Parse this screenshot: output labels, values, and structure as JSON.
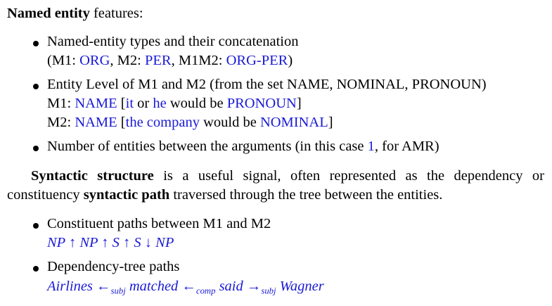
{
  "heading": {
    "bold": "Named entity",
    "rest": " features:"
  },
  "ne_items": [
    {
      "line1": "Named-entity types and their concatenation",
      "line2": {
        "p1": "(M1: ",
        "v1": "ORG",
        "p2": ", M2: ",
        "v2": "PER",
        "p3": ", M1M2: ",
        "v3": "ORG-PER",
        "p4": ")"
      }
    },
    {
      "line1": "Entity Level of M1 and M2 (from the set NAME, NOMINAL, PRONOUN)",
      "line2": {
        "p1": "M1: ",
        "v1": "NAME",
        "p2": " [",
        "v2": "it",
        "p3": " or ",
        "v3": "he",
        "p4": " would be ",
        "v4": "PRONOUN",
        "p5": "]"
      },
      "line3": {
        "p1": "M2: ",
        "v1": "NAME",
        "p2": " [",
        "v2": "the company",
        "p3": " would be ",
        "v3": "NOMINAL",
        "p4": "]"
      }
    },
    {
      "line1": {
        "p1": "Number of entities between the arguments (in this case ",
        "v1": "1",
        "p2": ", for AMR)"
      }
    }
  ],
  "paragraph": {
    "line1": {
      "bold1": "Syntactic structure",
      "rest1": " is a useful signal, often represented as the dependency or"
    },
    "line2": {
      "text1": "constituency ",
      "bold2": "syntactic path",
      "rest2": " traversed through the tree between the entities."
    }
  },
  "syn_items": [
    {
      "line1": "Constituent paths between M1 and M2",
      "path": "NP ↑ NP ↑ S ↑ S ↓ NP"
    },
    {
      "line1": "Dependency-tree paths",
      "dep": {
        "w1": "Airlines",
        "a1": "←",
        "s1": "subj",
        "w2": "matched",
        "a2": "←",
        "s2": "comp",
        "w3": "said",
        "a3": "→",
        "s3": "subj",
        "w4": "Wagner"
      }
    }
  ],
  "colors": {
    "text": "#000000",
    "highlight": "#1a1ad6"
  }
}
